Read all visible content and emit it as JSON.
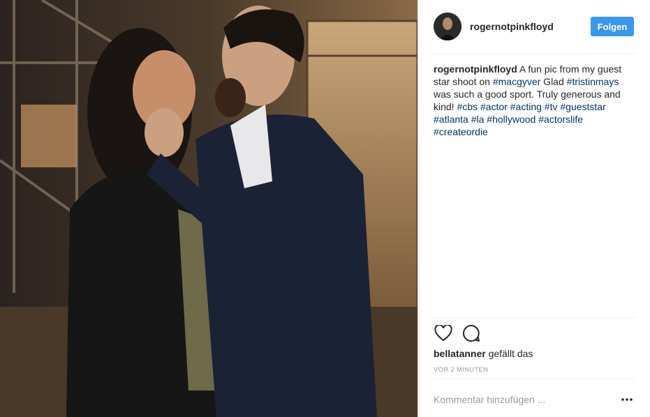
{
  "post": {
    "username": "rogernotpinkfloyd",
    "follow_label": "Folgen",
    "caption": {
      "username": "rogernotpinkfloyd",
      "parts": [
        {
          "text": " A fun pic from my guest star shoot on ",
          "tag": false
        },
        {
          "text": "#macgyver",
          "tag": true
        },
        {
          "text": " Glad ",
          "tag": false
        },
        {
          "text": "#tristinmays",
          "tag": true
        },
        {
          "text": " was such a good sport. Truly generous and kind! ",
          "tag": false
        },
        {
          "text": "#cbs",
          "tag": true
        },
        {
          "text": " ",
          "tag": false
        },
        {
          "text": "#actor",
          "tag": true
        },
        {
          "text": " ",
          "tag": false
        },
        {
          "text": "#acting",
          "tag": true
        },
        {
          "text": " ",
          "tag": false
        },
        {
          "text": "#tv",
          "tag": true
        },
        {
          "text": " ",
          "tag": false
        },
        {
          "text": "#gueststar",
          "tag": true
        },
        {
          "text": " ",
          "tag": false
        },
        {
          "text": "#atlanta",
          "tag": true
        },
        {
          "text": " ",
          "tag": false
        },
        {
          "text": "#la",
          "tag": true
        },
        {
          "text": " ",
          "tag": false
        },
        {
          "text": "#hollywood",
          "tag": true
        },
        {
          "text": " ",
          "tag": false
        },
        {
          "text": "#actorslife",
          "tag": true
        },
        {
          "text": " ",
          "tag": false
        },
        {
          "text": "#createordie",
          "tag": true
        }
      ]
    },
    "likes": {
      "liker": "bellatanner",
      "suffix": "gefällt das"
    },
    "time": "VOR 2 MINUTEN",
    "comment_placeholder": "Kommentar hinzufügen ...",
    "icons": {
      "like": "heart-icon",
      "comment": "comment-icon",
      "more": "more-options-icon"
    },
    "colors": {
      "follow_button": "#3897f0",
      "hashtag": "#003569",
      "muted": "#999999"
    }
  }
}
